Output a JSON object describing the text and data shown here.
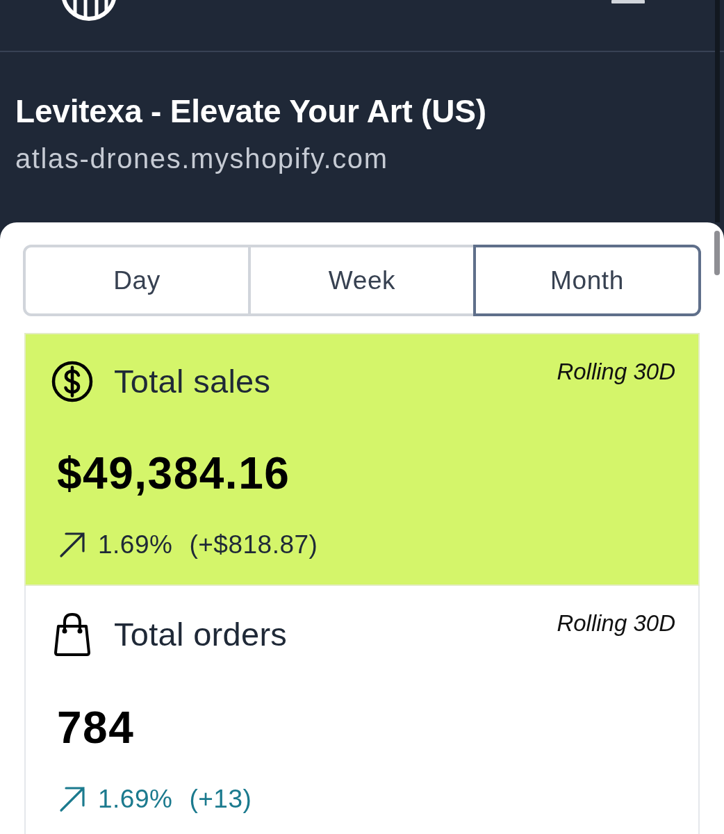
{
  "header": {
    "store_name": "Levitexa - Elevate Your Art (US)",
    "store_domain": "atlas-drones.myshopify.com"
  },
  "period_tabs": [
    {
      "label": "Day",
      "selected": false
    },
    {
      "label": "Week",
      "selected": false
    },
    {
      "label": "Month",
      "selected": true
    }
  ],
  "metrics": [
    {
      "kind": "currency",
      "title": "Total sales",
      "window": "Rolling 30D",
      "highlighted": true,
      "value": "$49,384.16",
      "change": {
        "rising": true,
        "percent": "1.69%",
        "amount": "(+$818.87)"
      }
    },
    {
      "kind": "count",
      "title": "Total orders",
      "window": "Rolling 30D",
      "highlighted": false,
      "value": "784",
      "change": {
        "rising": true,
        "percent": "1.69%",
        "amount": "(+13)"
      }
    }
  ]
}
